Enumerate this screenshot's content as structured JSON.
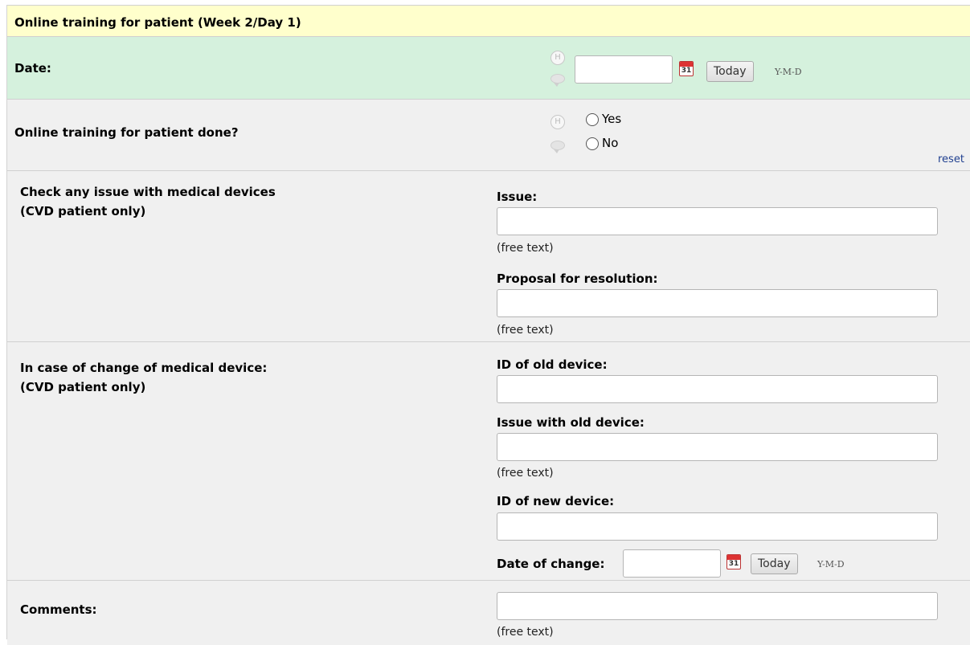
{
  "form": {
    "title": "Online training for patient (Week 2/Day 1)",
    "date": {
      "label": "Date:",
      "value": "",
      "today_label": "Today",
      "format": "Y-M-D",
      "calendar_day": "31"
    },
    "done": {
      "label": "Online training for patient done?",
      "options": [
        "Yes",
        "No"
      ],
      "selected": null,
      "reset_label": "reset"
    },
    "issue_section": {
      "label_line1": "Check any issue with medical devices",
      "label_line2": "(CVD patient only)",
      "issue_label": "Issue:",
      "issue_value": "",
      "issue_note": "(free text)",
      "proposal_label": "Proposal for resolution:",
      "proposal_value": "",
      "proposal_note": "(free text)"
    },
    "change_section": {
      "label_line1": "In case of change of medical device:",
      "label_line2": "(CVD patient only)",
      "old_id_label": "ID of old device:",
      "old_id_value": "",
      "old_issue_label": "Issue with old device:",
      "old_issue_value": "",
      "old_issue_note": "(free text)",
      "new_id_label": "ID of new device:",
      "new_id_value": "",
      "date_label": "Date of change:",
      "date_value": "",
      "today_label": "Today",
      "format": "Y-M-D",
      "calendar_day": "31"
    },
    "comments": {
      "label": "Comments:",
      "value": "",
      "note": "(free text)"
    }
  }
}
